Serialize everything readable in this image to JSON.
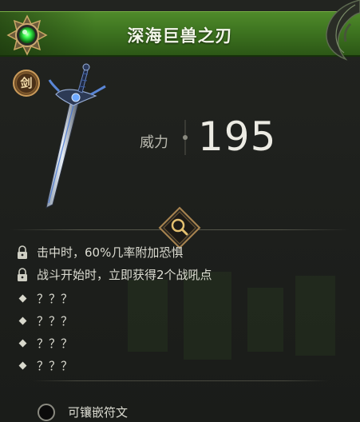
{
  "item": {
    "name": "深海巨兽之刃",
    "type_label": "剑",
    "power_label": "威力",
    "power_value": "195"
  },
  "attributes": [
    {
      "icon": "lock-icon",
      "text": "击中时，60%几率附加恐惧"
    },
    {
      "icon": "lock-icon",
      "text": "战斗开始时，立即获得2个战吼点"
    },
    {
      "icon": "diamond-bullet",
      "text": "？？？"
    },
    {
      "icon": "diamond-bullet",
      "text": "？？？"
    },
    {
      "icon": "diamond-bullet",
      "text": "？？？"
    },
    {
      "icon": "diamond-bullet",
      "text": "？？？"
    }
  ],
  "rune_slot": {
    "label": "可镶嵌符文"
  },
  "colors": {
    "header_green": "#3e7420",
    "gem_green": "#3cff50",
    "gold": "#b48a4a",
    "background": "#1d1f1c"
  }
}
